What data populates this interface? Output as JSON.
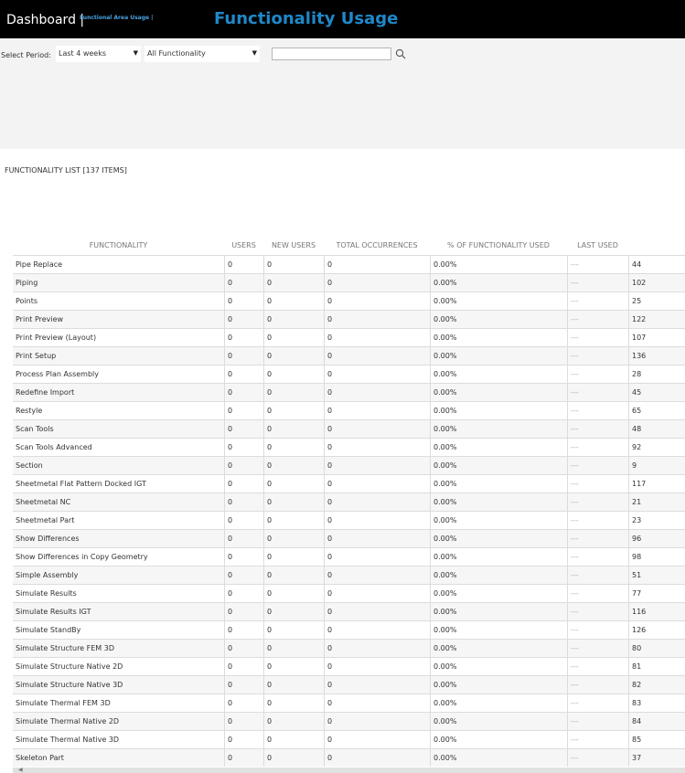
{
  "header": {
    "brand": "Dashboard |",
    "breadcrumb": "Functional Area Usage |",
    "title": "Functionality Usage"
  },
  "filters": {
    "period_label": "Select Period:",
    "period_value": "Last 4 weeks",
    "functionality_value": "All Functionality",
    "search_value": "",
    "search_placeholder": ""
  },
  "list": {
    "title": "FUNCTIONALITY LIST [137 ITEMS]"
  },
  "table": {
    "columns": [
      "FUNCTIONALITY",
      "USERS",
      "NEW USERS",
      "TOTAL OCCURRENCES",
      "% OF FUNCTIONALITY USED",
      "LAST USED"
    ],
    "rows": [
      {
        "name": "Pipe Replace",
        "users": "0",
        "new_users": "0",
        "total": "0",
        "percent": "0.00%",
        "last_used": "---",
        "extra": "44"
      },
      {
        "name": "Piping",
        "users": "0",
        "new_users": "0",
        "total": "0",
        "percent": "0.00%",
        "last_used": "---",
        "extra": "102"
      },
      {
        "name": "Points",
        "users": "0",
        "new_users": "0",
        "total": "0",
        "percent": "0.00%",
        "last_used": "---",
        "extra": "25"
      },
      {
        "name": "Print Preview",
        "users": "0",
        "new_users": "0",
        "total": "0",
        "percent": "0.00%",
        "last_used": "---",
        "extra": "122"
      },
      {
        "name": "Print Preview (Layout)",
        "users": "0",
        "new_users": "0",
        "total": "0",
        "percent": "0.00%",
        "last_used": "---",
        "extra": "107"
      },
      {
        "name": "Print Setup",
        "users": "0",
        "new_users": "0",
        "total": "0",
        "percent": "0.00%",
        "last_used": "---",
        "extra": "136"
      },
      {
        "name": "Process Plan Assembly",
        "users": "0",
        "new_users": "0",
        "total": "0",
        "percent": "0.00%",
        "last_used": "---",
        "extra": "28"
      },
      {
        "name": "Redefine Import",
        "users": "0",
        "new_users": "0",
        "total": "0",
        "percent": "0.00%",
        "last_used": "---",
        "extra": "45"
      },
      {
        "name": "Restyle",
        "users": "0",
        "new_users": "0",
        "total": "0",
        "percent": "0.00%",
        "last_used": "---",
        "extra": "65"
      },
      {
        "name": "Scan Tools",
        "users": "0",
        "new_users": "0",
        "total": "0",
        "percent": "0.00%",
        "last_used": "---",
        "extra": "48"
      },
      {
        "name": "Scan Tools Advanced",
        "users": "0",
        "new_users": "0",
        "total": "0",
        "percent": "0.00%",
        "last_used": "---",
        "extra": "92"
      },
      {
        "name": "Section",
        "users": "0",
        "new_users": "0",
        "total": "0",
        "percent": "0.00%",
        "last_used": "---",
        "extra": "9"
      },
      {
        "name": "Sheetmetal Flat Pattern Docked IGT",
        "users": "0",
        "new_users": "0",
        "total": "0",
        "percent": "0.00%",
        "last_used": "---",
        "extra": "117"
      },
      {
        "name": "Sheetmetal NC",
        "users": "0",
        "new_users": "0",
        "total": "0",
        "percent": "0.00%",
        "last_used": "---",
        "extra": "21"
      },
      {
        "name": "Sheetmetal Part",
        "users": "0",
        "new_users": "0",
        "total": "0",
        "percent": "0.00%",
        "last_used": "---",
        "extra": "23"
      },
      {
        "name": "Show Differences",
        "users": "0",
        "new_users": "0",
        "total": "0",
        "percent": "0.00%",
        "last_used": "---",
        "extra": "96"
      },
      {
        "name": "Show Differences in Copy Geometry",
        "users": "0",
        "new_users": "0",
        "total": "0",
        "percent": "0.00%",
        "last_used": "---",
        "extra": "98"
      },
      {
        "name": "Simple Assembly",
        "users": "0",
        "new_users": "0",
        "total": "0",
        "percent": "0.00%",
        "last_used": "---",
        "extra": "51"
      },
      {
        "name": "Simulate Results",
        "users": "0",
        "new_users": "0",
        "total": "0",
        "percent": "0.00%",
        "last_used": "---",
        "extra": "77"
      },
      {
        "name": "Simulate Results IGT",
        "users": "0",
        "new_users": "0",
        "total": "0",
        "percent": "0.00%",
        "last_used": "---",
        "extra": "116"
      },
      {
        "name": "Simulate StandBy",
        "users": "0",
        "new_users": "0",
        "total": "0",
        "percent": "0.00%",
        "last_used": "---",
        "extra": "126"
      },
      {
        "name": "Simulate Structure FEM 3D",
        "users": "0",
        "new_users": "0",
        "total": "0",
        "percent": "0.00%",
        "last_used": "---",
        "extra": "80"
      },
      {
        "name": "Simulate Structure Native 2D",
        "users": "0",
        "new_users": "0",
        "total": "0",
        "percent": "0.00%",
        "last_used": "---",
        "extra": "81"
      },
      {
        "name": "Simulate Structure Native 3D",
        "users": "0",
        "new_users": "0",
        "total": "0",
        "percent": "0.00%",
        "last_used": "---",
        "extra": "82"
      },
      {
        "name": "Simulate Thermal FEM 3D",
        "users": "0",
        "new_users": "0",
        "total": "0",
        "percent": "0.00%",
        "last_used": "---",
        "extra": "83"
      },
      {
        "name": "Simulate Thermal Native 2D",
        "users": "0",
        "new_users": "0",
        "total": "0",
        "percent": "0.00%",
        "last_used": "---",
        "extra": "84"
      },
      {
        "name": "Simulate Thermal Native 3D",
        "users": "0",
        "new_users": "0",
        "total": "0",
        "percent": "0.00%",
        "last_used": "---",
        "extra": "85"
      },
      {
        "name": "Skeleton Part",
        "users": "0",
        "new_users": "0",
        "total": "0",
        "percent": "0.00%",
        "last_used": "---",
        "extra": "37"
      }
    ]
  },
  "icons": {
    "search": "search-icon",
    "dropdown": "chevron-down-icon",
    "scroll_left": "arrow-left-icon"
  },
  "colors": {
    "header_bg": "#000000",
    "title": "#1e88c9",
    "breadcrumb": "#4aa3df",
    "filter_bg": "#f3f3f3"
  }
}
